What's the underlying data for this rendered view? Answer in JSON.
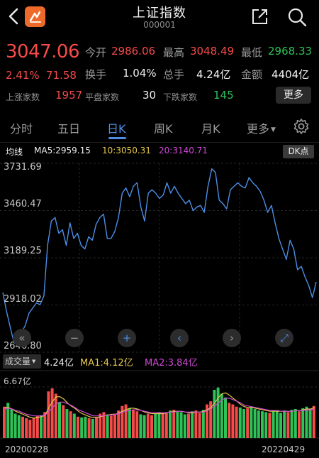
{
  "header": {
    "title": "上证指数",
    "code": "000001"
  },
  "quote": {
    "price": "3047.06",
    "change_pct": "2.41%",
    "change": "71.58",
    "open_label": "今开",
    "open": "2986.06",
    "high_label": "最高",
    "high": "3048.49",
    "low_label": "最低",
    "low": "2968.33",
    "turnover_label": "换手",
    "turnover": "1.04%",
    "volume_label": "总手",
    "volume": "4.24亿",
    "amount_label": "金额",
    "amount": "4404亿",
    "up_label": "上涨家数",
    "up": "1957",
    "flat_label": "平盘家数",
    "flat": "30",
    "down_label": "下跌家数",
    "down": "145",
    "more_label": "更多"
  },
  "tabs": [
    "分时",
    "五日",
    "日K",
    "周K",
    "月K",
    "更多"
  ],
  "active_tab": "日K",
  "ma": {
    "label": "均线",
    "ma5": "MA5:2959.15",
    "ma10": "10:3050.31",
    "ma20": "20:3140.71",
    "dk_label": "DK点"
  },
  "volume_panel": {
    "selector_label": "成交量",
    "vol": "4.24亿",
    "ma1": "MA1:4.12亿",
    "ma2": "MA2:3.84亿",
    "max_label": "6.67亿"
  },
  "controls": [
    "«",
    "−",
    "+",
    "‹",
    "›",
    "⤢"
  ],
  "colors": {
    "up": "#f64b49",
    "down": "#2fc257",
    "line": "#4c8ee6",
    "ma10": "#e6c84a",
    "ma20": "#d048d6",
    "accent": "#4c8ee6"
  },
  "chart_data": {
    "type": "line",
    "start_date": "20200228",
    "end_date": "20220429",
    "ylim": [
      2646.8,
      3731.69
    ],
    "yticks": [
      "3731.69",
      "3460.47",
      "3189.25",
      "2918.02",
      "2646.80"
    ],
    "values": [
      2990,
      2880,
      2790,
      2700,
      2690,
      2760,
      2800,
      2870,
      2900,
      2930,
      2920,
      2970,
      3260,
      3400,
      3420,
      3330,
      3350,
      3260,
      3390,
      3300,
      3330,
      3260,
      3240,
      3310,
      3290,
      3380,
      3420,
      3440,
      3300,
      3300,
      3340,
      3420,
      3560,
      3590,
      3540,
      3600,
      3620,
      3480,
      3400,
      3560,
      3580,
      3560,
      3530,
      3550,
      3620,
      3560,
      3600,
      3560,
      3530,
      3500,
      3520,
      3460,
      3480,
      3490,
      3450,
      3600,
      3700,
      3680,
      3520,
      3500,
      3470,
      3580,
      3600,
      3620,
      3600,
      3590,
      3650,
      3620,
      3600,
      3570,
      3520,
      3450,
      3490,
      3390,
      3300,
      3240,
      3180,
      3290,
      3240,
      3120,
      3140,
      3080,
      3030,
      2960,
      3050
    ],
    "volume": {
      "max": 6.67,
      "unit": "亿",
      "values": [
        4.1,
        4.6,
        3.8,
        3.2,
        3.0,
        2.8,
        2.6,
        2.4,
        2.6,
        2.9,
        3.0,
        3.4,
        6.1,
        6.5,
        5.8,
        4.7,
        4.3,
        3.8,
        3.5,
        3.2,
        2.8,
        2.7,
        2.8,
        2.6,
        2.5,
        2.7,
        3.2,
        3.4,
        3.1,
        2.9,
        3.2,
        3.6,
        4.2,
        4.4,
        3.9,
        3.7,
        3.5,
        3.1,
        3.0,
        3.2,
        3.0,
        3.3,
        3.4,
        3.2,
        3.4,
        3.6,
        3.7,
        3.5,
        3.4,
        3.1,
        3.2,
        3.5,
        3.6,
        3.3,
        3.7,
        4.4,
        4.8,
        6.3,
        6.6,
        5.8,
        5.3,
        4.6,
        4.4,
        4.1,
        4.0,
        3.8,
        3.9,
        4.1,
        3.8,
        3.6,
        3.5,
        3.4,
        3.3,
        3.6,
        3.5,
        3.3,
        3.6,
        3.4,
        3.7,
        3.8,
        3.5,
        3.9,
        4.1,
        3.8,
        4.2
      ],
      "ma1": [
        4.0,
        4.0,
        3.8,
        3.5,
        3.3,
        3.1,
        2.9,
        2.7,
        2.6,
        2.7,
        2.8,
        3.0,
        4.0,
        4.8,
        5.4,
        5.4,
        5.1,
        4.6,
        4.2,
        3.9,
        3.5,
        3.2,
        3.0,
        2.8,
        2.7,
        2.7,
        2.8,
        2.9,
        3.0,
        3.1,
        3.1,
        3.3,
        3.5,
        3.7,
        3.9,
        3.9,
        3.8,
        3.6,
        3.4,
        3.3,
        3.2,
        3.2,
        3.2,
        3.2,
        3.3,
        3.4,
        3.5,
        3.5,
        3.5,
        3.4,
        3.3,
        3.3,
        3.4,
        3.4,
        3.5,
        3.7,
        4.0,
        4.6,
        5.3,
        5.8,
        5.9,
        5.6,
        5.2,
        4.8,
        4.4,
        4.1,
        4.0,
        4.0,
        3.9,
        3.8,
        3.7,
        3.6,
        3.5,
        3.5,
        3.5,
        3.5,
        3.5,
        3.5,
        3.5,
        3.6,
        3.6,
        3.7,
        3.8,
        3.8,
        4.0
      ],
      "ma2": [
        3.8,
        3.9,
        3.8,
        3.6,
        3.5,
        3.3,
        3.1,
        3.0,
        2.9,
        2.9,
        2.9,
        3.0,
        3.5,
        4.0,
        4.5,
        4.7,
        4.7,
        4.5,
        4.3,
        4.0,
        3.7,
        3.5,
        3.3,
        3.1,
        2.9,
        2.9,
        2.9,
        2.9,
        3.0,
        3.0,
        3.1,
        3.2,
        3.4,
        3.5,
        3.6,
        3.7,
        3.7,
        3.6,
        3.5,
        3.4,
        3.3,
        3.3,
        3.3,
        3.3,
        3.3,
        3.4,
        3.4,
        3.5,
        3.5,
        3.4,
        3.4,
        3.4,
        3.4,
        3.4,
        3.4,
        3.6,
        3.8,
        4.2,
        4.6,
        5.0,
        5.2,
        5.2,
        5.0,
        4.8,
        4.6,
        4.3,
        4.2,
        4.1,
        4.0,
        3.9,
        3.8,
        3.7,
        3.6,
        3.6,
        3.6,
        3.5,
        3.5,
        3.5,
        3.5,
        3.6,
        3.6,
        3.6,
        3.7,
        3.7,
        3.8
      ]
    }
  }
}
